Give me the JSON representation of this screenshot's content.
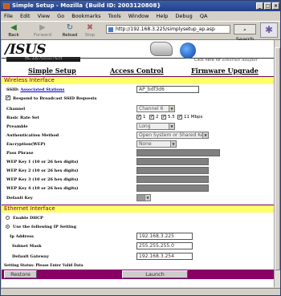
{
  "window": {
    "title": "Simple Setup - Mozilla {Build ID: 2003120808}"
  },
  "menu": [
    "File",
    "Edit",
    "View",
    "Go",
    "Bookmarks",
    "Tools",
    "Window",
    "Help",
    "Debug",
    "QA"
  ],
  "toolbar": {
    "back": "Back",
    "forward": "Forward",
    "reload": "Reload",
    "stop": "Stop",
    "url": "http://192.168.3.225/simplysetup_ap.asp",
    "search": "Search"
  },
  "header": {
    "logo": "/ISUS",
    "subtitle": "WL-330 Access Point",
    "click_text": "Click here for",
    "click_link": "Ethernet Adapter"
  },
  "nav": {
    "simple_setup": "Simple Setup",
    "access_control": "Access Control",
    "firmware_upgrade": "Firmware Upgrade"
  },
  "wireless": {
    "title": "Wireless Interface",
    "ssid_label": "SSID:",
    "associated_link": "Associated Stations",
    "ssid_value": "AP_bdf3d6",
    "broadcast_label": "Respond to Broadcast SSID Requests",
    "broadcast_checked": true,
    "channel_label": "Channel",
    "channel_value": "Channel 6",
    "basic_rate_label": "Basic Rate Set",
    "rates": [
      "1",
      "2",
      "5.5",
      "11 Mbps"
    ],
    "preamble_label": "Preamble",
    "preamble_value": "Long",
    "auth_label": "Authentication Method",
    "auth_value": "Open System or Shared Key",
    "encryption_label": "Encryption(WEP)",
    "encryption_value": "None",
    "passphrase_label": "Pass Phrase",
    "wep_labels": [
      "WEP Key 1 (10 or 26 hex digits)",
      "WEP Key 2 (10 or 26 hex digits)",
      "WEP Key 3 (10 or 26 hex digits)",
      "WEP Key 4 (10 or 26 hex digits)"
    ],
    "default_key_label": "Default Key"
  },
  "ethernet": {
    "title": "Ethernet Interface",
    "dhcp_label": "Enable DHCP",
    "static_label": "Use the following IP Setting",
    "ip_label": "Ip Address",
    "ip_value": "192.168.3.225",
    "mask_label": "Subnet Mask",
    "mask_value": "255.255.255.0",
    "gateway_label": "Default Gateway",
    "gateway_value": "192.168.3.254"
  },
  "status": "Setting Status: Please Enter Valid Data",
  "buttons": {
    "restore": "Restore",
    "launch": "Launch"
  }
}
